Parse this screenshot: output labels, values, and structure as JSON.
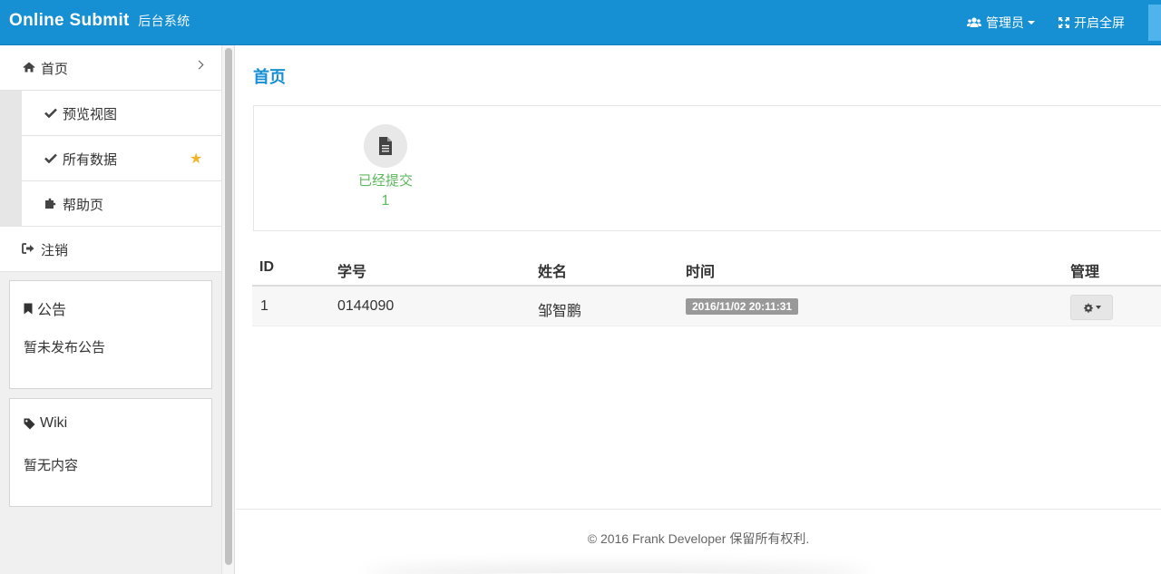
{
  "navbar": {
    "brand": "Online Submit",
    "brand_sub": "后台系统",
    "admin_label": "管理员",
    "fullscreen_label": "开启全屏"
  },
  "sidebar": {
    "home": "首页",
    "sub_items": [
      {
        "label": "预览视图",
        "icon": "check-icon"
      },
      {
        "label": "所有数据",
        "icon": "check-icon",
        "starred": true
      },
      {
        "label": "帮助页",
        "icon": "puzzle-icon"
      }
    ],
    "logout": "注销",
    "notice": {
      "title": "公告",
      "body": "暂未发布公告"
    },
    "wiki": {
      "title": "Wiki",
      "body": "暂无内容"
    }
  },
  "main": {
    "page_title": "首页",
    "stat": {
      "label": "已经提交",
      "count": "1"
    },
    "table": {
      "headers": [
        "ID",
        "学号",
        "姓名",
        "时间",
        "管理"
      ],
      "rows": [
        {
          "id": "1",
          "student_no": "0144090",
          "name": "邹智鹏",
          "time": "2016/11/02 20:11:31"
        }
      ]
    },
    "footer": "© 2016 Frank Developer 保留所有权利."
  },
  "colors": {
    "primary": "#168fd3",
    "success": "#5cb85c",
    "star": "#f0b528",
    "badge": "#999999"
  }
}
